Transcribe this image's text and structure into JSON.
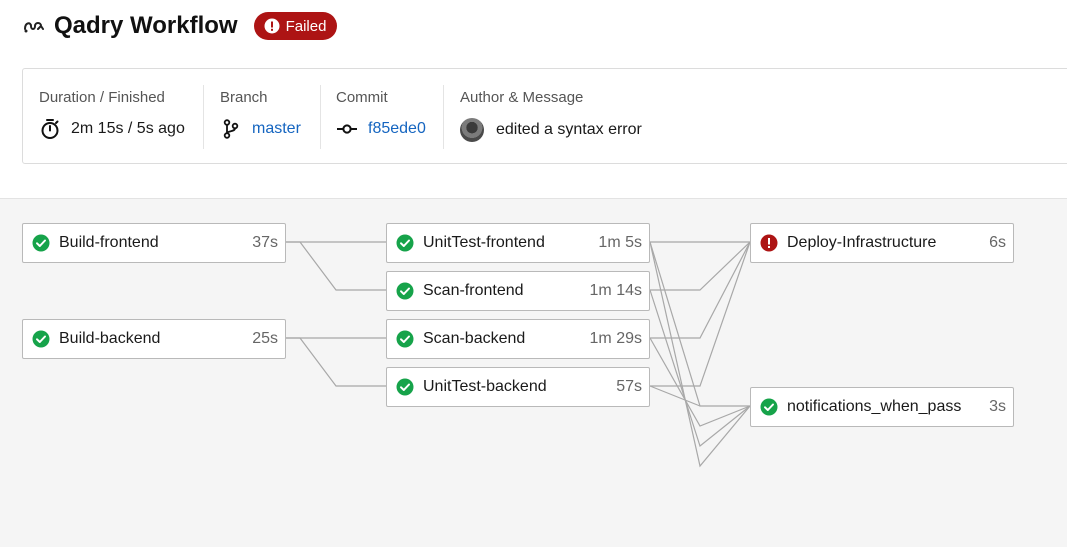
{
  "workflow": {
    "icon": "workflow-icon",
    "title": "Qadry Workflow",
    "status": {
      "label": "Failed",
      "icon": "alert-circle-icon",
      "color": "#ad1414"
    }
  },
  "summary": {
    "duration": {
      "label": "Duration / Finished",
      "value": "2m 15s / 5s ago",
      "icon": "stopwatch-icon"
    },
    "branch": {
      "label": "Branch",
      "value": "master",
      "icon": "git-branch-icon"
    },
    "commit": {
      "label": "Commit",
      "value": "f85ede0",
      "icon": "git-commit-icon"
    },
    "author": {
      "label": "Author & Message",
      "message": "edited a syntax error",
      "icon": "avatar"
    }
  },
  "colors": {
    "success": "#16a34a",
    "failure": "#ad1414",
    "link": "#1565c0"
  },
  "jobs": {
    "build_frontend": {
      "name": "Build-frontend",
      "duration": "37s",
      "status": "success"
    },
    "build_backend": {
      "name": "Build-backend",
      "duration": "25s",
      "status": "success"
    },
    "unittest_frontend": {
      "name": "UnitTest-frontend",
      "duration": "1m 5s",
      "status": "success"
    },
    "scan_frontend": {
      "name": "Scan-frontend",
      "duration": "1m 14s",
      "status": "success"
    },
    "scan_backend": {
      "name": "Scan-backend",
      "duration": "1m 29s",
      "status": "success"
    },
    "unittest_backend": {
      "name": "UnitTest-backend",
      "duration": "57s",
      "status": "success"
    },
    "deploy_infrastructure": {
      "name": "Deploy-Infrastructure",
      "duration": "6s",
      "status": "failed"
    },
    "notifications_when_pass": {
      "name": "notifications_when_pass",
      "duration": "3s",
      "status": "success"
    }
  }
}
